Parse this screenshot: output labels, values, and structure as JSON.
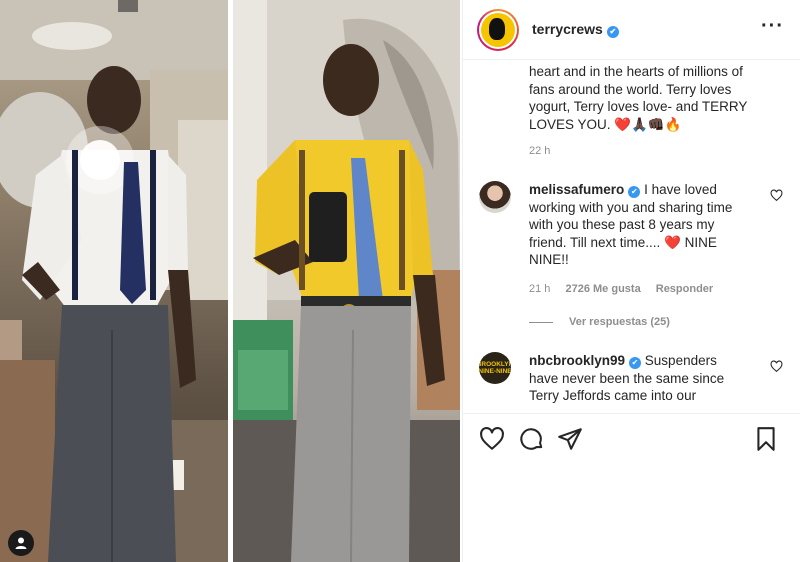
{
  "post": {
    "username": "terrycrews",
    "more_icon": "more-horizontal-icon",
    "caption_lines": [
      "heart and in the hearts of millions of",
      "fans around the world. Terry loves",
      "yogurt, Terry loves love- and TERRY",
      "LOVES YOU. ❤️🙏🏿👊🏿🔥"
    ],
    "caption_time": "22 h"
  },
  "comments": [
    {
      "username": "melissafumero",
      "text": "I have loved working with you and sharing time with you these past 8 years my friend. Till next time.... ❤️ NINE NINE!!",
      "time": "21 h",
      "likes": "2726 Me gusta",
      "reply": "Responder",
      "view_replies": "Ver respuestas (25)"
    },
    {
      "username": "nbcbrooklyn99",
      "avatar_text": "BROOKLYN NINE-NINE",
      "text": "Suspenders have never been the same since Terry Jeffords came into our"
    }
  ],
  "actions": {
    "like_icon": "heart-icon",
    "comment_icon": "comment-icon",
    "share_icon": "paper-plane-icon",
    "save_icon": "bookmark-icon"
  },
  "colors": {
    "verified": "#3897f0",
    "meta_text": "#8e8e8e",
    "text": "#262626",
    "border": "#efefef"
  }
}
